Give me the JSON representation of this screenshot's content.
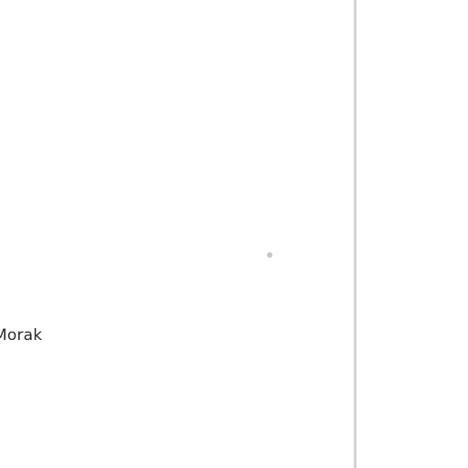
{
  "content": {
    "name_text": "Morak"
  },
  "colors": {
    "background": "#ffffff",
    "divider": "#d4d4d4",
    "dot": "#c6c6c6",
    "text": "#2a2a2a"
  },
  "icons": {
    "dot": "dot-icon"
  }
}
